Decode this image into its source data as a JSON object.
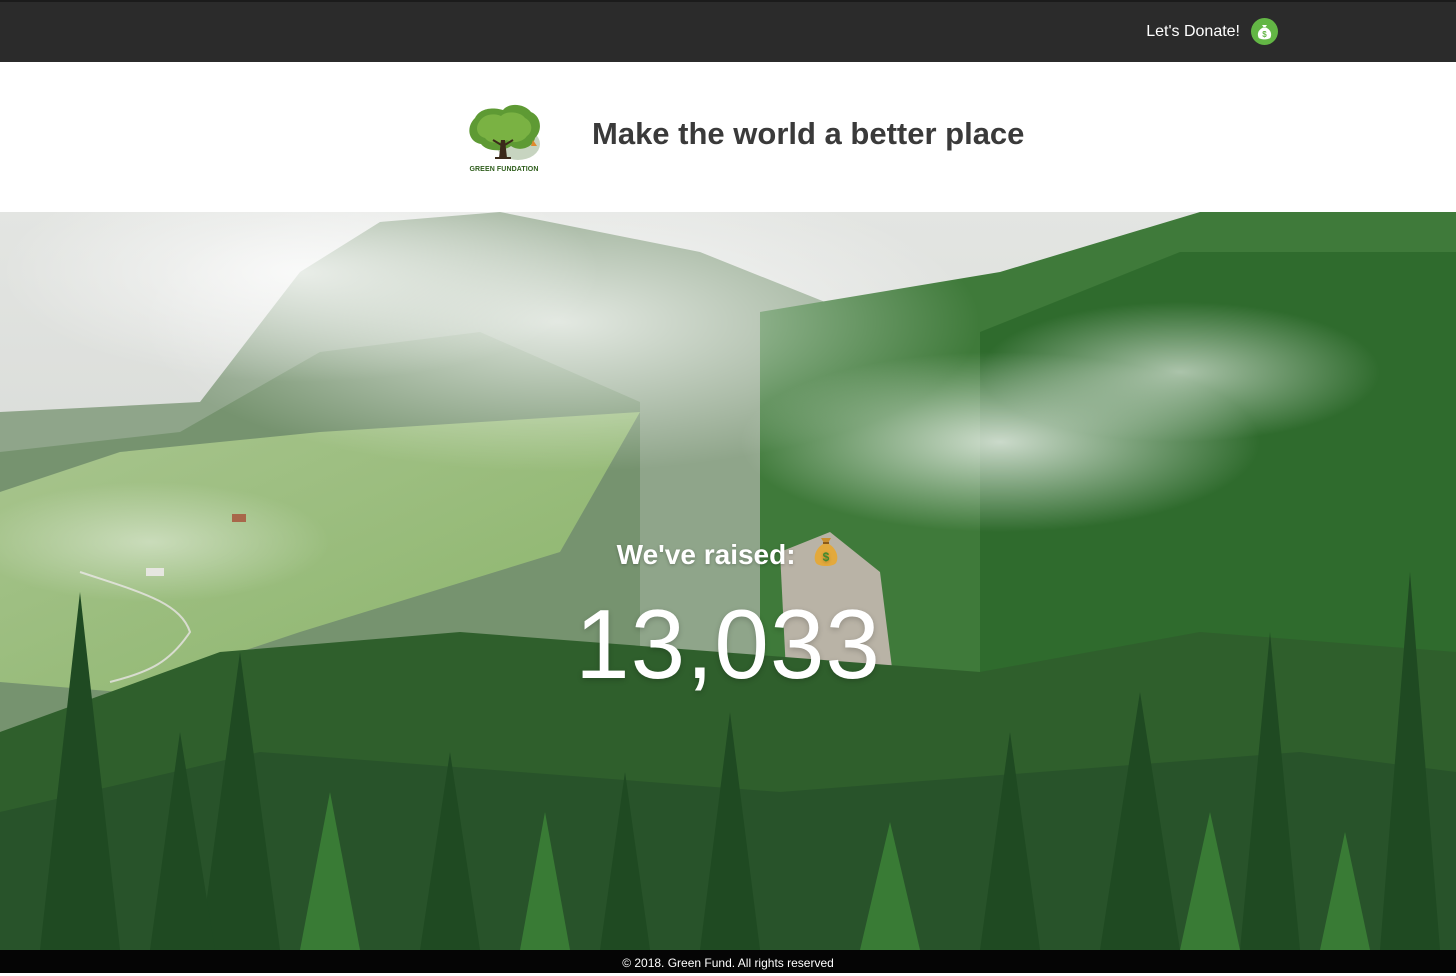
{
  "nav": {
    "donate_label": "Let's Donate!",
    "donate_icon": "money-bag-icon",
    "accent_color": "#63b645"
  },
  "header": {
    "logo_text": "GREEN FUNDATION",
    "tagline": "Make the world a better place"
  },
  "hero": {
    "raised_label": "We've raised:",
    "raised_icon": "money-bag-icon",
    "raised_amount": "13,033"
  },
  "footer": {
    "copyright": "© 2018. Green Fund. All rights reserved"
  }
}
